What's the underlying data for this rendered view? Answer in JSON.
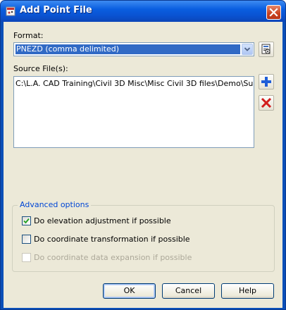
{
  "window": {
    "title": "Add Point File",
    "close_icon": "close-icon"
  },
  "format": {
    "label": "Format:",
    "selected": "PNEZD (comma delimited)"
  },
  "source": {
    "label": "Source File(s):",
    "files": [
      "C:\\L.A. CAD Training\\Civil 3D Misc\\Misc Civil 3D files\\Demo\\Survey Demo\\"
    ]
  },
  "advanced": {
    "title": "Advanced options",
    "options": [
      {
        "label": "Do elevation adjustment if possible",
        "checked": true,
        "enabled": true
      },
      {
        "label": "Do coordinate transformation if possible",
        "checked": false,
        "enabled": true
      },
      {
        "label": "Do coordinate data expansion if possible",
        "checked": false,
        "enabled": false
      }
    ]
  },
  "buttons": {
    "ok": "OK",
    "cancel": "Cancel",
    "help": "Help"
  },
  "colors": {
    "titlebar": "#0a53d2",
    "selection": "#316ac5",
    "group_title": "#0046d5",
    "add_icon": "#1f5ed8",
    "remove_icon": "#d21d1d"
  }
}
